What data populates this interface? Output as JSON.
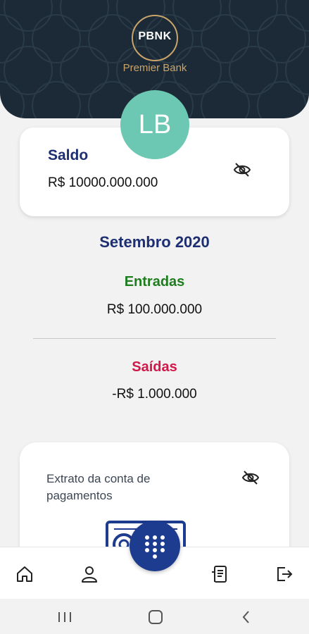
{
  "header": {
    "logo_text": "PBNK",
    "bank_name": "Premier Bank",
    "pattern_text": "PBNK"
  },
  "avatar": {
    "initials": "LB"
  },
  "balance": {
    "title": "Saldo",
    "value": "R$ 10000.000.000",
    "visibility_icon": "eye-off-icon"
  },
  "summary": {
    "month": "Setembro 2020",
    "in_label": "Entradas",
    "in_value": "R$ 100.000.000",
    "out_label": "Saídas",
    "out_value": "-R$ 1.000.000"
  },
  "statement": {
    "title": "Extrato da conta de pagamentos",
    "visibility_icon": "eye-off-icon"
  },
  "bottom_nav": {
    "items": [
      "home-icon",
      "profile-icon",
      "keypad-icon",
      "statement-icon",
      "logout-icon"
    ]
  },
  "colors": {
    "header_bg": "#1b2a36",
    "gold": "#c9a46a",
    "navy": "#1d2f72",
    "avatar_bg": "#6cc8b3",
    "in_green": "#1f7d1f",
    "out_red": "#d0184a",
    "fab": "#1d3b8f"
  }
}
